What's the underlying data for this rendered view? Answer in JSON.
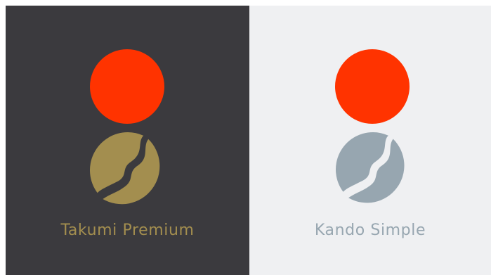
{
  "brands": [
    {
      "name": "Takumi Premium",
      "background": "#3b3a3e",
      "sun_color": "#ff3300",
      "emblem_color": "#a38e4f",
      "label_color": "#a38e4f"
    },
    {
      "name": "Kando Simple",
      "background": "#eff0f2",
      "sun_color": "#ff3300",
      "emblem_color": "#97a6b0",
      "label_color": "#97a6b0"
    }
  ]
}
